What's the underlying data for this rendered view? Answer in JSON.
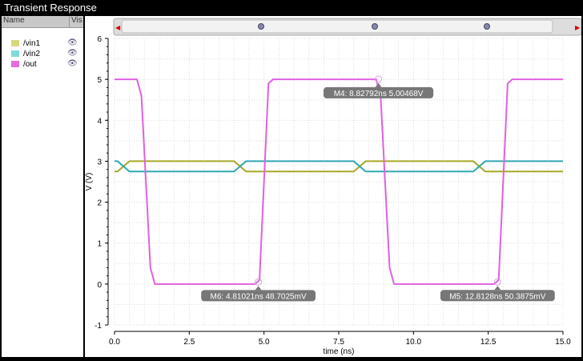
{
  "window": {
    "title": "Transient Response"
  },
  "legend": {
    "col_name": "Name",
    "col_vis": "Vis",
    "items": [
      {
        "label": "/vin1",
        "color": "#b8b840",
        "icon": "eye-icon"
      },
      {
        "label": "/vin2",
        "color": "#40c0c0",
        "icon": "eye-icon"
      },
      {
        "label": "/out",
        "color": "#e060e0",
        "icon": "eye-icon"
      }
    ]
  },
  "chart_data": {
    "type": "line",
    "xlabel": "time (ns)",
    "ylabel": "V (V)",
    "xlim": [
      0,
      15
    ],
    "ylim": [
      -1,
      6
    ],
    "xticks": [
      "0.0",
      "2.5",
      "5.0",
      "7.5",
      "10.0",
      "12.5",
      "15.0"
    ],
    "yticks": [
      "-1",
      "0",
      "1",
      "2",
      "3",
      "4",
      "5",
      "6"
    ],
    "grid": true,
    "series": [
      {
        "name": "/vin1",
        "color": "#a8a828",
        "x": [
          0,
          0.1,
          0.5,
          4.0,
          4.4,
          8.0,
          8.4,
          12.0,
          12.4,
          15
        ],
        "y": [
          2.75,
          2.75,
          3,
          3,
          2.75,
          2.75,
          3,
          3,
          2.75,
          2.75
        ]
      },
      {
        "name": "/vin2",
        "color": "#30a8b0",
        "x": [
          0,
          0.1,
          0.5,
          4.0,
          4.4,
          8.0,
          8.4,
          12.0,
          12.4,
          15
        ],
        "y": [
          3,
          3,
          2.75,
          2.75,
          3,
          3,
          2.75,
          2.75,
          3,
          3
        ]
      },
      {
        "name": "/out",
        "color": "#e060e0",
        "x": [
          0,
          0.75,
          0.9,
          1.05,
          1.2,
          1.35,
          4.7,
          4.85,
          5.0,
          5.15,
          5.3,
          8.75,
          8.9,
          9.05,
          9.2,
          9.35,
          12.7,
          12.85,
          13.0,
          13.15,
          13.3,
          15
        ],
        "y": [
          5,
          5,
          4.6,
          2.5,
          0.4,
          0,
          0,
          0.1,
          2.5,
          4.9,
          5,
          5,
          4.6,
          2.5,
          0.4,
          0,
          0,
          0.1,
          2.5,
          4.9,
          5,
          5
        ]
      }
    ],
    "markers": [
      {
        "label": "M4: 8.82792ns 5.00468V",
        "x": 8.82792,
        "y": 5.00468
      },
      {
        "label": "M6: 4.81021ns 48.7025mV",
        "x": 4.81021,
        "y": 0.0487025
      },
      {
        "label": "M5: 12.8128ns 50.3875mV",
        "x": 12.8128,
        "y": 0.0503875
      }
    ]
  }
}
